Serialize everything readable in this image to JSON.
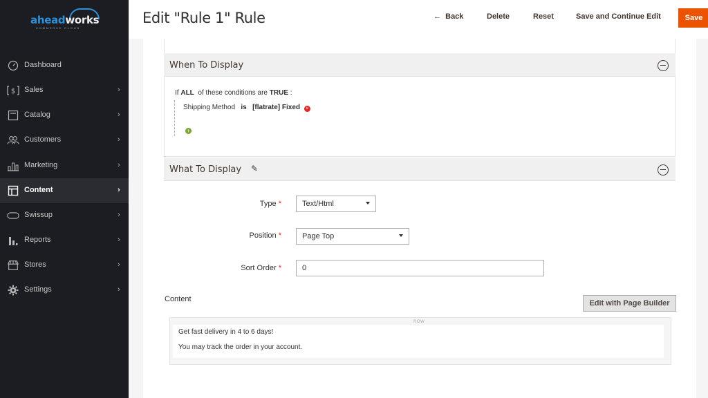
{
  "logo": {
    "text_a": "ahead",
    "text_b": "works",
    "sub": "COMMERCE CLOUD"
  },
  "sidebar": {
    "items": [
      {
        "label": "Dashboard",
        "icon": "dashboard-icon",
        "has_chevron": false
      },
      {
        "label": "Sales",
        "icon": "dollar-icon",
        "has_chevron": true
      },
      {
        "label": "Catalog",
        "icon": "catalog-icon",
        "has_chevron": true
      },
      {
        "label": "Customers",
        "icon": "customers-icon",
        "has_chevron": true
      },
      {
        "label": "Marketing",
        "icon": "marketing-icon",
        "has_chevron": true
      },
      {
        "label": "Content",
        "icon": "content-icon",
        "has_chevron": true,
        "active": true
      },
      {
        "label": "Swissup",
        "icon": "swissup-icon",
        "has_chevron": true
      },
      {
        "label": "Reports",
        "icon": "reports-icon",
        "has_chevron": true
      },
      {
        "label": "Stores",
        "icon": "stores-icon",
        "has_chevron": true
      },
      {
        "label": "Settings",
        "icon": "gear-icon",
        "has_chevron": true
      }
    ]
  },
  "header": {
    "title": "Edit \"Rule 1\" Rule",
    "back": "Back",
    "delete": "Delete",
    "reset": "Reset",
    "save_continue": "Save and Continue Edit",
    "save": "Save"
  },
  "when_section": {
    "title": "When To Display",
    "cond_if": "If",
    "cond_all": "ALL",
    "cond_mid": "of these conditions are",
    "cond_true": "TRUE",
    "cond_colon": ":",
    "rule_attr": "Shipping Method",
    "rule_op": "is",
    "rule_value": "[flatrate] Fixed"
  },
  "what_section": {
    "title": "What To Display",
    "type_label": "Type",
    "type_value": "Text/Html",
    "position_label": "Position",
    "position_value": "Page Top",
    "sort_label": "Sort Order",
    "sort_value": "0"
  },
  "content_field": {
    "label": "Content",
    "pb_button": "Edit with Page Builder",
    "row_tag": "ROW",
    "line1": "Get fast delivery in 4 to 6 days!",
    "line2": "You may track the order in your account."
  },
  "colors": {
    "accent": "#eb5202",
    "sidebar_bg": "#1b1d22",
    "logo_blue": "#2f8fd8"
  }
}
